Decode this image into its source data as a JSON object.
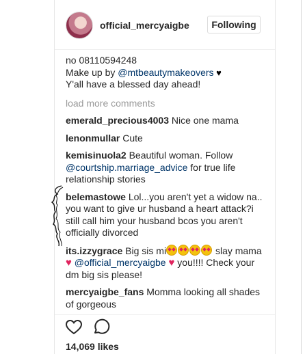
{
  "header": {
    "username": "official_mercyaigbe",
    "follow_label": "Following"
  },
  "caption": {
    "line1": "no 08110594248",
    "line2_prefix": "Make up by ",
    "line2_mention": "@mtbeautymakeovers",
    "line2_suffix": " ♥",
    "line3": "Y'all have a blessed day ahead!"
  },
  "load_more": "load more comments",
  "comments": [
    {
      "user": "emerald_precious4003",
      "text": " Nice one mama"
    },
    {
      "user": "lenonmullar",
      "text": " Cute"
    },
    {
      "user": "kemisinuola2",
      "text": " Beautiful woman. Follow ",
      "mention": "@courtship.marriage_advice",
      "after": " for true life relationship stories"
    },
    {
      "user": "belemastowe",
      "text": " Lol...you aren't yet a widow na.. you want to give ur husband a heart attack?i still call him your husband bcos you aren't officially divorced"
    },
    {
      "user": "its.izzygrace",
      "text": " Big sis mi",
      "after_emoji": " slay mama ",
      "mention": "@official_mercyaigbe",
      "end": " you!!!! Check your dm big sis please!"
    },
    {
      "user": "mercyaigbe_fans",
      "text": " Momma looking all shades of gorgeous"
    }
  ],
  "likes": "14,069 likes",
  "icons": {
    "like": "heart-outline-icon",
    "comment": "speech-bubble-icon"
  }
}
